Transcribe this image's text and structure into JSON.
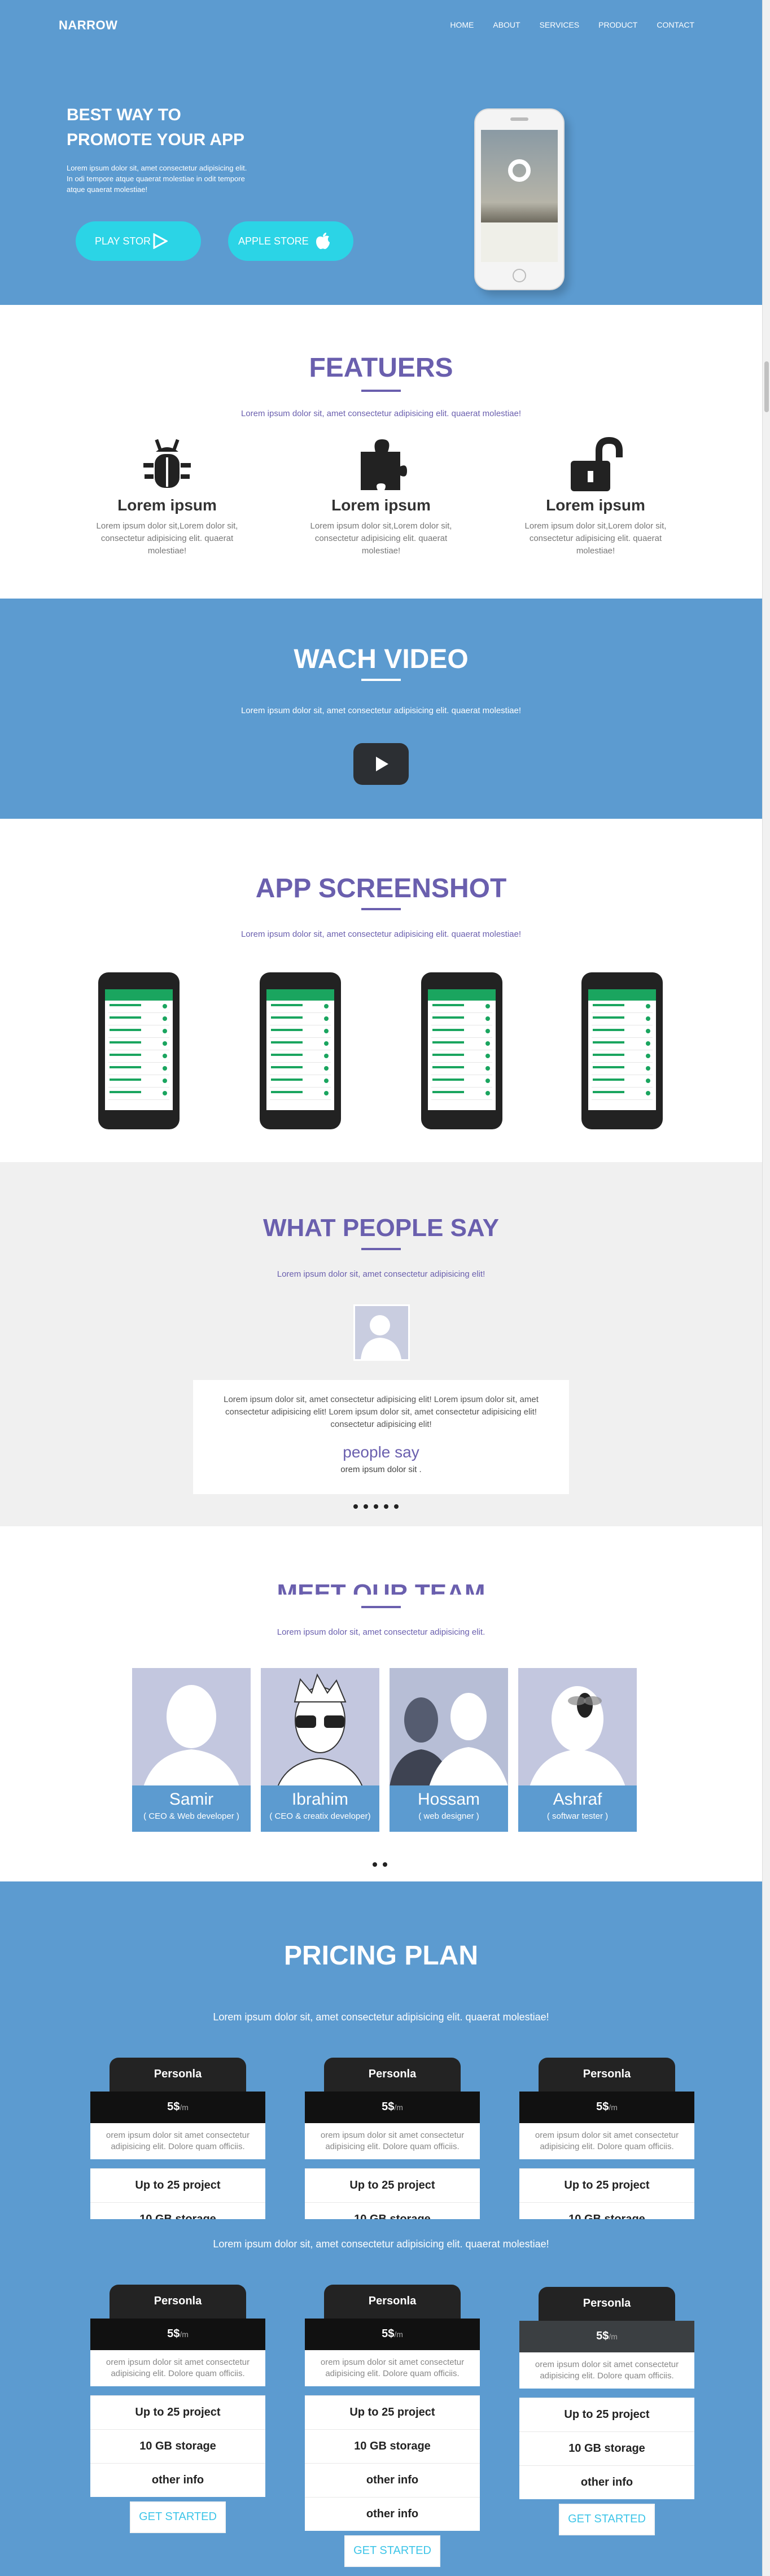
{
  "nav": {
    "brand": "NARROW",
    "items": [
      "HOME",
      "ABOUT",
      "SERVICES",
      "PRODUCT",
      "CONTACT"
    ]
  },
  "hero": {
    "title_line1": "BEST WAY TO",
    "title_line2": "PROMOTE YOUR APP",
    "text": "Lorem ipsum dolor sit, amet consectetur adipisicing elit. In odi tempore atque quaerat molestiae in odit tempore atque quaerat molestiae!",
    "play_store": "PLAY STOR",
    "apple_store": "APPLE STORE"
  },
  "features": {
    "title": "FEATUERS",
    "subtitle": "Lorem ipsum dolor sit, amet consectetur adipisicing elit. quaerat molestiae!",
    "items": [
      {
        "icon": "bug-icon",
        "heading": "Lorem ipsum",
        "text": "Lorem ipsum dolor sit,Lorem dolor sit, consectetur adipisicing elit. quaerat molestiae!"
      },
      {
        "icon": "puzzle-icon",
        "heading": "Lorem ipsum",
        "text": "Lorem ipsum dolor sit,Lorem dolor sit, consectetur adipisicing elit. quaerat molestiae!"
      },
      {
        "icon": "unlock-icon",
        "heading": "Lorem ipsum",
        "text": "Lorem ipsum dolor sit,Lorem dolor sit, consectetur adipisicing elit. quaerat molestiae!"
      }
    ]
  },
  "video": {
    "title": "WACH VIDEO",
    "subtitle": "Lorem ipsum dolor sit, amet consectetur adipisicing elit. quaerat molestiae!"
  },
  "screenshots": {
    "title": "APP SCREENSHOT",
    "subtitle": "Lorem ipsum dolor sit, amet consectetur adipisicing elit. quaerat molestiae!"
  },
  "testimonials": {
    "title": "WHAT PEOPLE SAY",
    "subtitle": "Lorem ipsum dolor sit, amet consectetur adipisicing elit!",
    "quote": "Lorem ipsum dolor sit, amet consectetur adipisicing elit! Lorem ipsum dolor sit, amet consectetur adipisicing elit! Lorem ipsum dolor sit, amet consectetur adipisicing elit! consectetur adipisicing elit!",
    "name": "people say",
    "role": "orem ipsum dolor sit ."
  },
  "team": {
    "title": "MEET OUR TEAM",
    "subtitle": "Lorem ipsum dolor sit, amet consectetur adipisicing elit.",
    "members": [
      {
        "name": "Samir",
        "role": "( CEO & Web developer )"
      },
      {
        "name": "Ibrahim",
        "role": "( CEO & creatix developer)"
      },
      {
        "name": "Hossam",
        "role": "( web designer )"
      },
      {
        "name": "Ashraf",
        "role": "( softwar tester )"
      }
    ]
  },
  "pricing": {
    "title": "PRICING PLAN",
    "subtitle": "Lorem ipsum dolor sit, amet consectetur adipisicing elit. quaerat molestiae!",
    "subtitle2": "Lorem ipsum dolor sit, amet consectetur adipisicing elit. quaerat molestiae!",
    "plan_name": "Personla",
    "price": "5$",
    "period": "/m",
    "desc": "orem ipsum dolor sit amet consectetur adipisicing elit. Dolore quam officiis.",
    "f1": "Up to 25 project",
    "f2": "10 GB storage",
    "f3": "other info",
    "button": "GET STARTED"
  }
}
